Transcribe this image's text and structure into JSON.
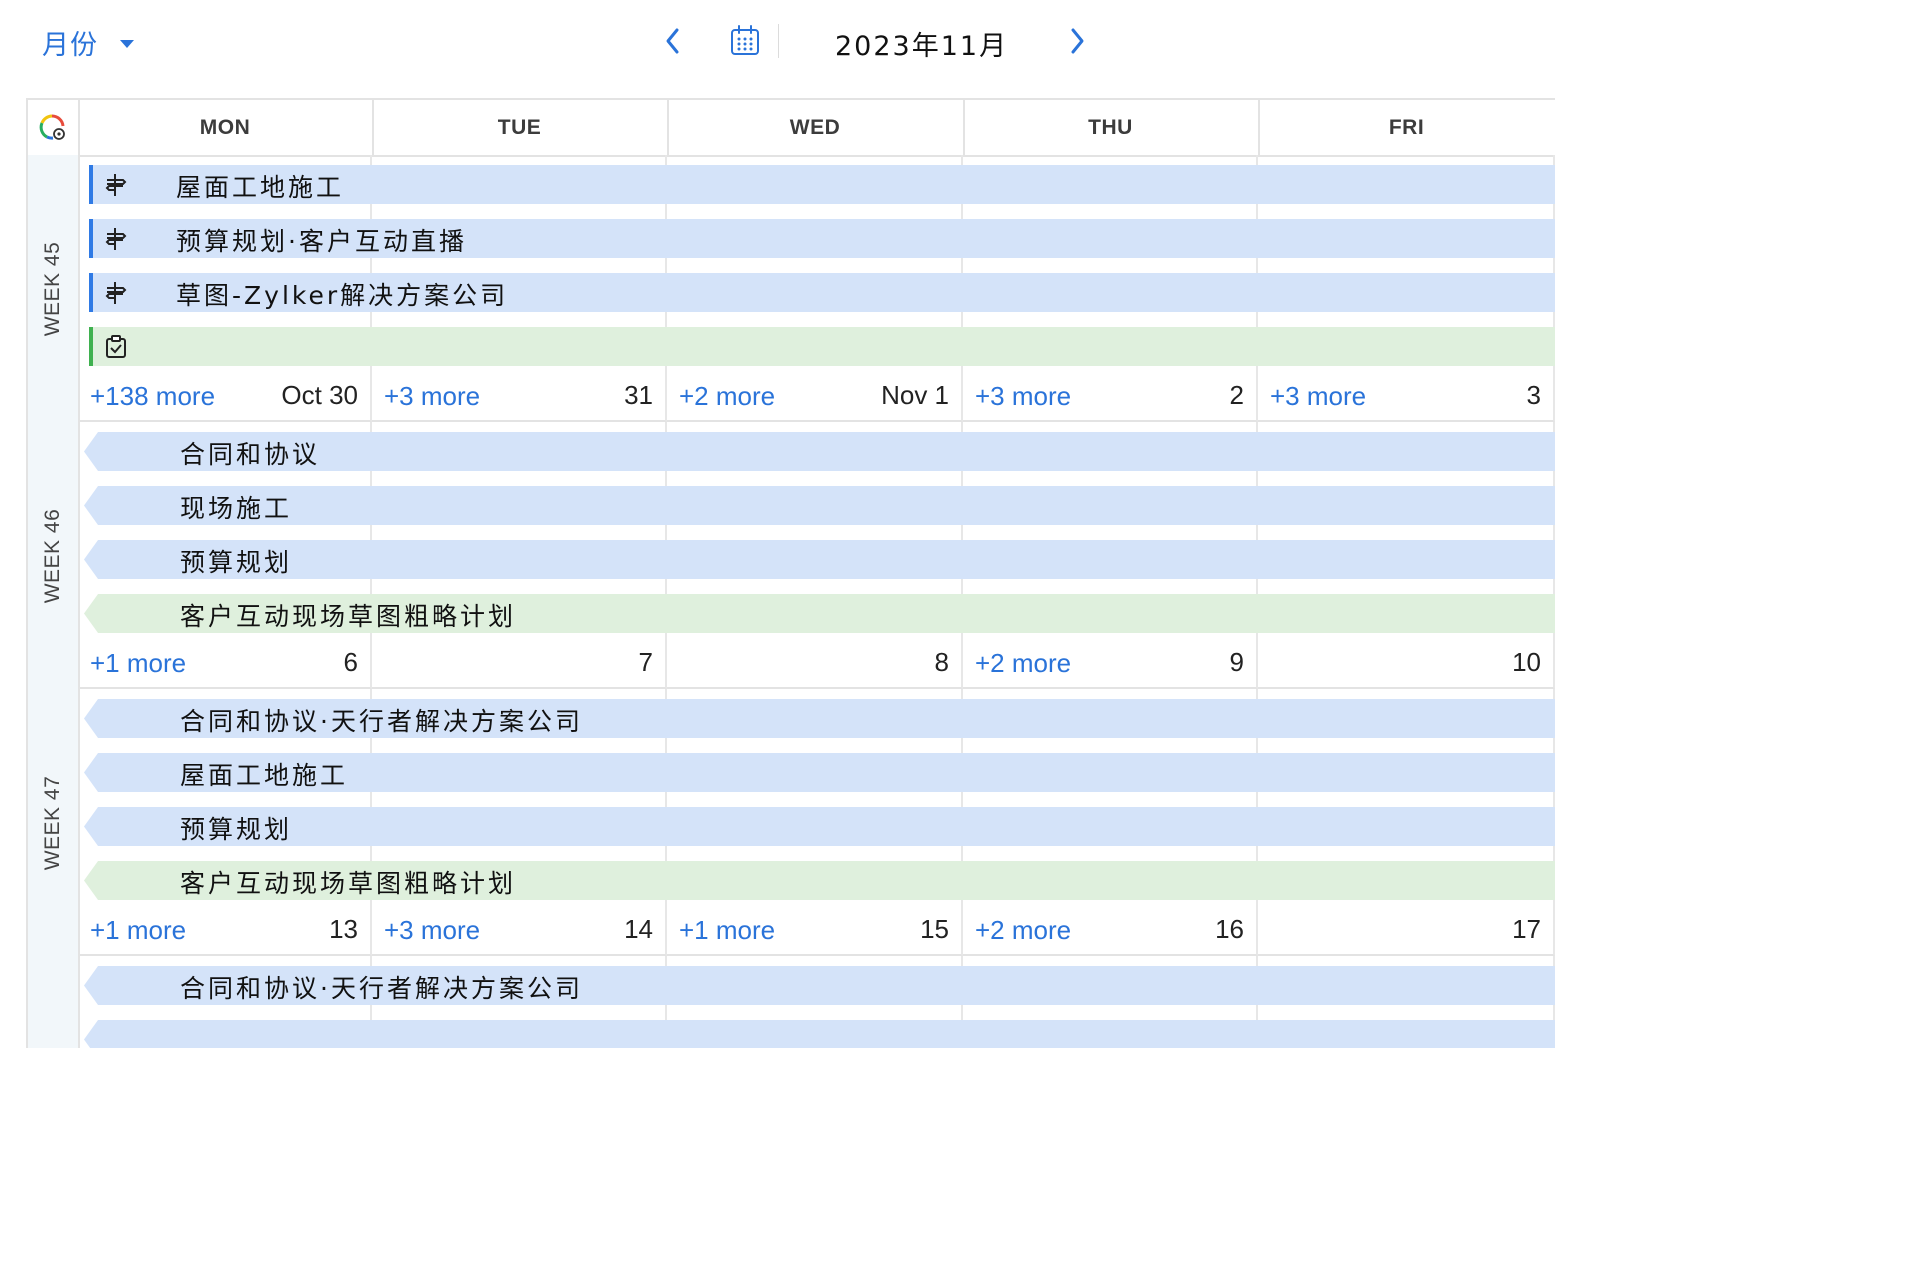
{
  "toolbar": {
    "view_label": "月份",
    "month_label": "2023年11月"
  },
  "colors": {
    "accent": "#2a73d9",
    "event_blue": "#d4e3f9",
    "event_green": "#dff0dd"
  },
  "days": [
    "MON",
    "TUE",
    "WED",
    "THU",
    "FRI"
  ],
  "weeks": [
    {
      "label": "WEEK 45",
      "dates": [
        "Oct 30",
        "31",
        "Nov 1",
        "2",
        "3"
      ],
      "more": [
        "+138 more",
        "+3 more",
        "+2 more",
        "+3 more",
        "+3 more"
      ],
      "events": [
        {
          "title": "屋面工地施工",
          "color": "blue",
          "icon": "milestone-icon"
        },
        {
          "title": "预算规划·客户互动直播",
          "color": "blue",
          "icon": "milestone-icon"
        },
        {
          "title": "草图-Zylker解决方案公司",
          "color": "blue",
          "icon": "milestone-icon"
        },
        {
          "title": "",
          "color": "green",
          "icon": "task-icon"
        }
      ]
    },
    {
      "label": "WEEK 46",
      "dates": [
        "6",
        "7",
        "8",
        "9",
        "10"
      ],
      "more": [
        "+1 more",
        "",
        "",
        "+2 more",
        ""
      ],
      "events": [
        {
          "title": "合同和协议",
          "color": "blue"
        },
        {
          "title": "现场施工",
          "color": "blue"
        },
        {
          "title": "预算规划",
          "color": "blue"
        },
        {
          "title": "客户互动现场草图粗略计划",
          "color": "green"
        }
      ]
    },
    {
      "label": "WEEK 47",
      "dates": [
        "13",
        "14",
        "15",
        "16",
        "17"
      ],
      "more": [
        "+1 more",
        "+3 more",
        "+1 more",
        "+2 more",
        ""
      ],
      "events": [
        {
          "title": "合同和协议·天行者解决方案公司",
          "color": "blue"
        },
        {
          "title": "屋面工地施工",
          "color": "blue"
        },
        {
          "title": "预算规划",
          "color": "blue"
        },
        {
          "title": "客户互动现场草图粗略计划",
          "color": "green"
        }
      ]
    },
    {
      "label": "",
      "dates": [
        "",
        "",
        "",
        "",
        ""
      ],
      "more": [
        "",
        "",
        "",
        "",
        ""
      ],
      "events": [
        {
          "title": "合同和协议·天行者解决方案公司",
          "color": "blue"
        },
        {
          "title": "",
          "color": "blue"
        }
      ]
    }
  ]
}
